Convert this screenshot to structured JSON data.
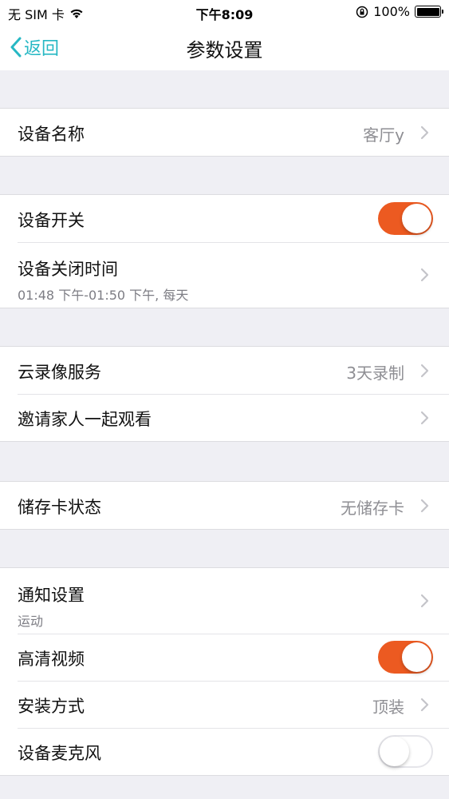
{
  "status_bar": {
    "carrier": "无 SIM 卡",
    "time": "下午8:09",
    "battery": "100%",
    "icons": [
      "wifi-icon",
      "rotation-lock-icon",
      "battery-icon"
    ]
  },
  "nav": {
    "back_label": "返回",
    "title": "参数设置",
    "accent_color": "#27b8c4"
  },
  "toggle_color": "#ec5a21",
  "groups": [
    {
      "rows": [
        {
          "label": "设备名称",
          "value": "客厅y",
          "type": "chevron"
        }
      ]
    },
    {
      "rows": [
        {
          "label": "设备开关",
          "type": "toggle",
          "on": true
        },
        {
          "label": "设备关闭时间",
          "subtitle": "01:48 下午-01:50 下午, 每天",
          "type": "chevron"
        }
      ]
    },
    {
      "rows": [
        {
          "label": "云录像服务",
          "value": "3天录制",
          "type": "chevron"
        },
        {
          "label": "邀请家人一起观看",
          "type": "chevron"
        }
      ]
    },
    {
      "rows": [
        {
          "label": "储存卡状态",
          "value": "无储存卡",
          "type": "chevron"
        }
      ]
    },
    {
      "rows": [
        {
          "label": "通知设置",
          "subtitle": "运动",
          "type": "chevron"
        },
        {
          "label": "高清视频",
          "type": "toggle",
          "on": true
        },
        {
          "label": "安装方式",
          "value": "顶装",
          "type": "chevron"
        },
        {
          "label": "设备麦克风",
          "type": "toggle",
          "on": false
        }
      ]
    }
  ]
}
